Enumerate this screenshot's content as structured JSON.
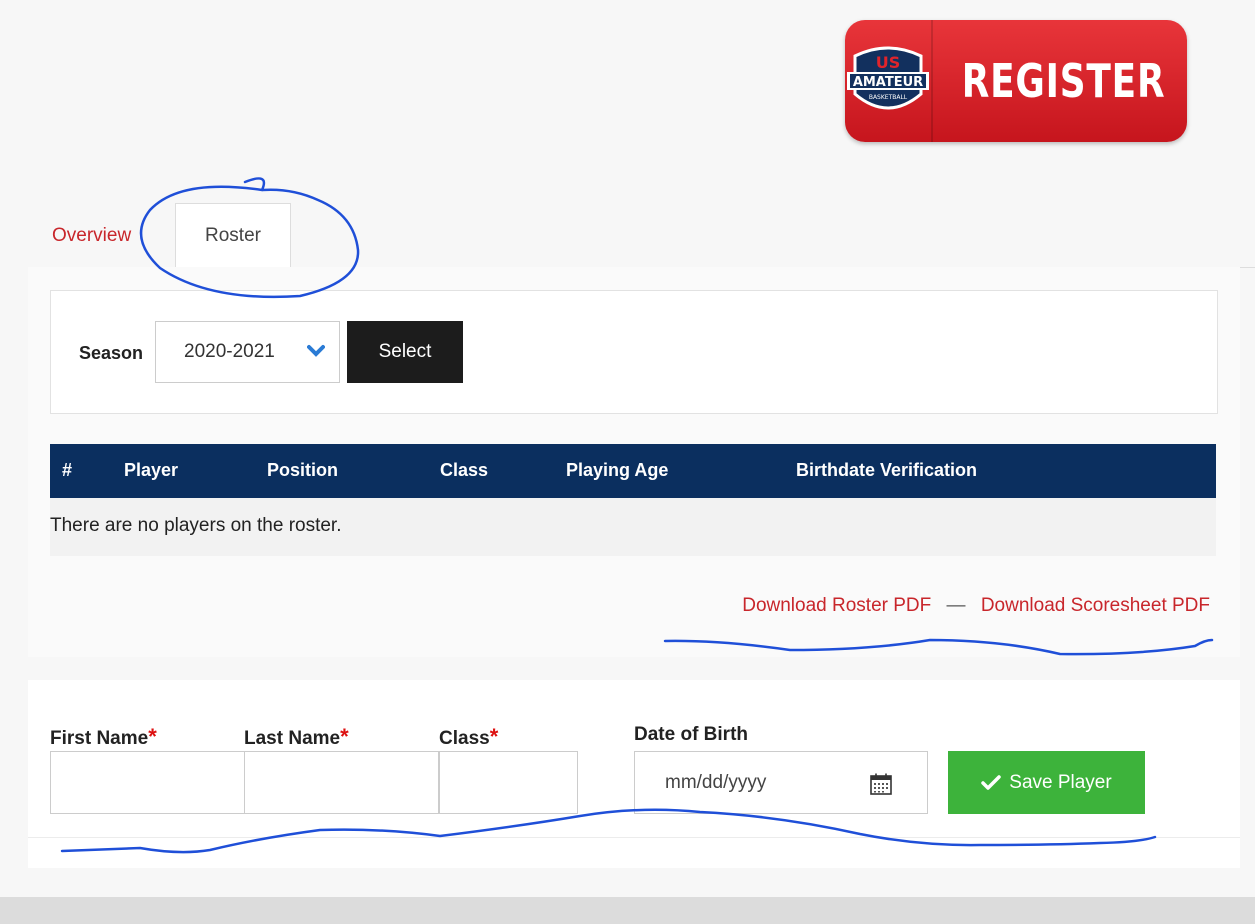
{
  "register": {
    "logo_text": "AMATEUR",
    "logo_top": "US",
    "logo_sub": "BASKETBALL",
    "label": "REGISTER"
  },
  "tabs": [
    {
      "label": "Overview",
      "active": false
    },
    {
      "label": "Roster",
      "active": true
    }
  ],
  "season": {
    "label": "Season",
    "selected": "2020-2021",
    "button": "Select"
  },
  "table": {
    "columns": [
      "#",
      "Player",
      "Position",
      "Class",
      "Playing Age",
      "Birthdate Verification"
    ],
    "empty_message": "There are no players on the roster."
  },
  "downloads": {
    "roster": "Download Roster PDF",
    "separator": "—",
    "scoresheet": "Download Scoresheet PDF"
  },
  "form": {
    "first_name_label": "First Name",
    "last_name_label": "Last Name",
    "class_label": "Class",
    "required_mark": "*",
    "dob_label": "Date of Birth",
    "dob_placeholder": "mm/dd/yyyy",
    "save_label": "Save Player"
  },
  "colors": {
    "accent_red": "#c8262b",
    "header_navy": "#0b2f5f",
    "save_green": "#3db33b",
    "annotation_blue": "#1f4fd8"
  }
}
